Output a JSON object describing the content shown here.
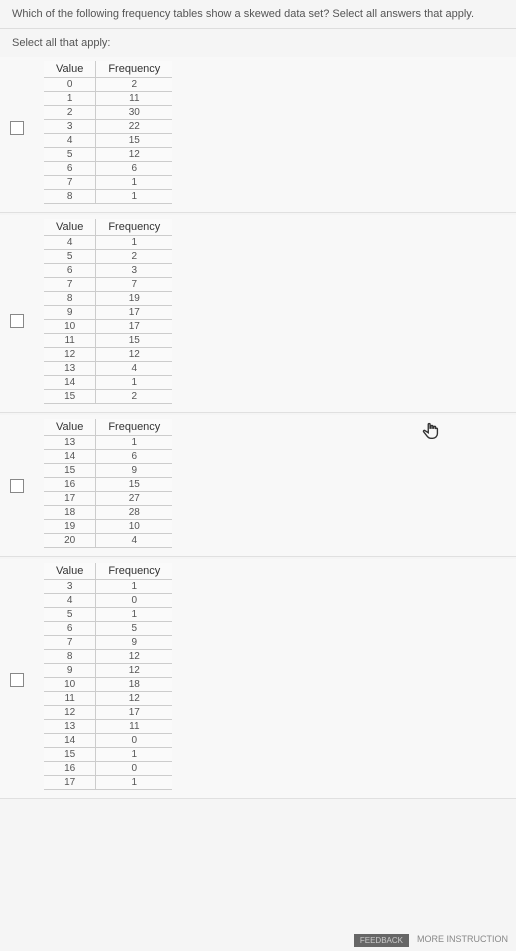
{
  "question": "Which of the following frequency tables show a skewed data set? Select all answers that apply.",
  "instruction": "Select all that apply:",
  "headers": {
    "value": "Value",
    "frequency": "Frequency"
  },
  "chart_data": [
    {
      "type": "table",
      "columns": [
        "Value",
        "Frequency"
      ],
      "rows": [
        [
          0,
          2
        ],
        [
          1,
          11
        ],
        [
          2,
          30
        ],
        [
          3,
          22
        ],
        [
          4,
          15
        ],
        [
          5,
          12
        ],
        [
          6,
          6
        ],
        [
          7,
          1
        ],
        [
          8,
          1
        ]
      ]
    },
    {
      "type": "table",
      "columns": [
        "Value",
        "Frequency"
      ],
      "rows": [
        [
          4,
          1
        ],
        [
          5,
          2
        ],
        [
          6,
          3
        ],
        [
          7,
          7
        ],
        [
          8,
          19
        ],
        [
          9,
          17
        ],
        [
          10,
          17
        ],
        [
          11,
          15
        ],
        [
          12,
          12
        ],
        [
          13,
          4
        ],
        [
          14,
          1
        ],
        [
          15,
          2
        ]
      ]
    },
    {
      "type": "table",
      "columns": [
        "Value",
        "Frequency"
      ],
      "rows": [
        [
          13,
          1
        ],
        [
          14,
          6
        ],
        [
          15,
          9
        ],
        [
          16,
          15
        ],
        [
          17,
          27
        ],
        [
          18,
          28
        ],
        [
          19,
          10
        ],
        [
          20,
          4
        ]
      ]
    },
    {
      "type": "table",
      "columns": [
        "Value",
        "Frequency"
      ],
      "rows": [
        [
          3,
          1
        ],
        [
          4,
          0
        ],
        [
          5,
          1
        ],
        [
          6,
          5
        ],
        [
          7,
          9
        ],
        [
          8,
          12
        ],
        [
          9,
          12
        ],
        [
          10,
          18
        ],
        [
          11,
          12
        ],
        [
          12,
          17
        ],
        [
          13,
          11
        ],
        [
          14,
          0
        ],
        [
          15,
          1
        ],
        [
          16,
          0
        ],
        [
          17,
          1
        ]
      ]
    }
  ],
  "footer": {
    "feedback": "FEEDBACK",
    "more": "MORE INSTRUCTION"
  }
}
